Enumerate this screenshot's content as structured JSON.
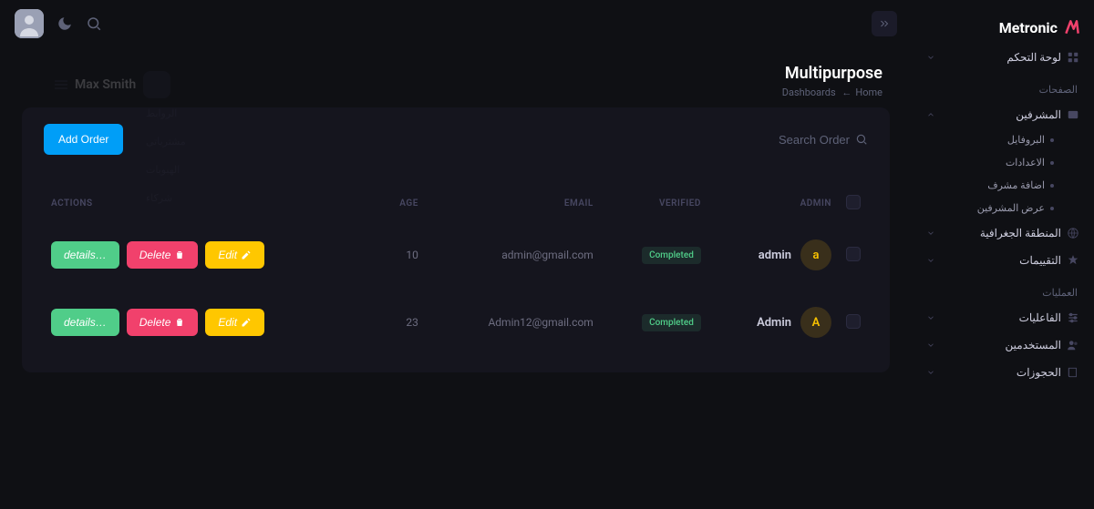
{
  "brand": {
    "name": "Metronic"
  },
  "header": {
    "title": "Multipurpose",
    "breadcrumb": {
      "home": "Home",
      "dashboards": "Dashboards"
    }
  },
  "ghost": {
    "name": "Max Smith",
    "lines": [
      "الروابط",
      "مشترياتي",
      "الهبوبات",
      "",
      "شركاء"
    ]
  },
  "sidebar": {
    "dashboard": {
      "label": "لوحة التحكم"
    },
    "sections": {
      "pages": "الصفحات",
      "operations": "العمليات"
    },
    "supervisors": {
      "label": "المشرفين",
      "items": [
        "البروفايل",
        "الاعدادات",
        "اضافة مشرف",
        "عرض المشرفين"
      ]
    },
    "geo": {
      "label": "المنطقة الجغرافية"
    },
    "ratings": {
      "label": "التقييمات"
    },
    "events": {
      "label": "الفاعليات"
    },
    "users": {
      "label": "المستخدمين"
    },
    "bookings": {
      "label": "الحجوزات"
    }
  },
  "card": {
    "add_btn": "Add Order",
    "search_placeholder": "Search Order"
  },
  "table": {
    "headers": {
      "actions": "ACTIONS",
      "age": "AGE",
      "email": "EMAIL",
      "verified": "VERIFIED",
      "admin": "ADMIN"
    },
    "btns": {
      "details": "details…",
      "delete": "Delete",
      "edit": "Edit"
    },
    "rows": [
      {
        "admin": "admin",
        "avatar": "a",
        "verified": "Completed",
        "email": "admin@gmail.com",
        "age": "10"
      },
      {
        "admin": "Admin",
        "avatar": "A",
        "verified": "Completed",
        "email": "Admin12@gmail.com",
        "age": "23"
      }
    ]
  }
}
